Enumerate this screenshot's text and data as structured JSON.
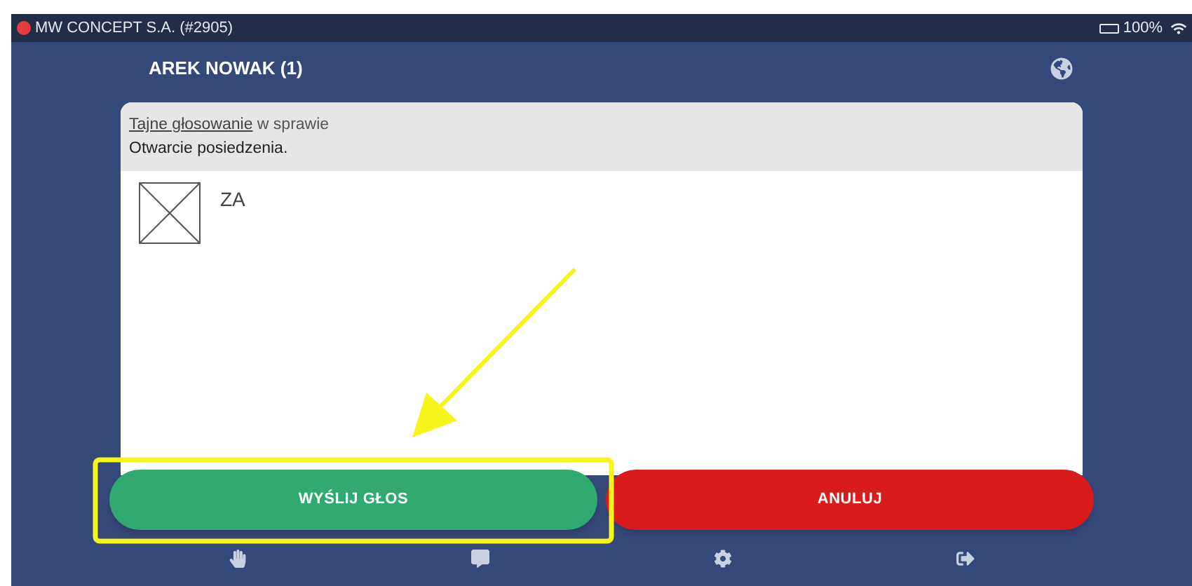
{
  "status_bar": {
    "organization": "MW CONCEPT S.A. (#2905)",
    "battery": "100%"
  },
  "header": {
    "title": "AREK NOWAK (1)"
  },
  "card": {
    "vote_type_link": "Tajne głosowanie",
    "vote_type_suffix": " w sprawie",
    "subject": "Otwarcie posiedzenia.",
    "options": [
      {
        "label": "ZA"
      }
    ]
  },
  "buttons": [
    {
      "label": "WYŚLIJ GŁOS",
      "kind": "submit"
    },
    {
      "label": "ANULUJ",
      "kind": "cancel"
    }
  ],
  "nav": [
    {
      "kind": "hand"
    },
    {
      "kind": "chat"
    },
    {
      "kind": "settings"
    },
    {
      "kind": "logout"
    }
  ]
}
